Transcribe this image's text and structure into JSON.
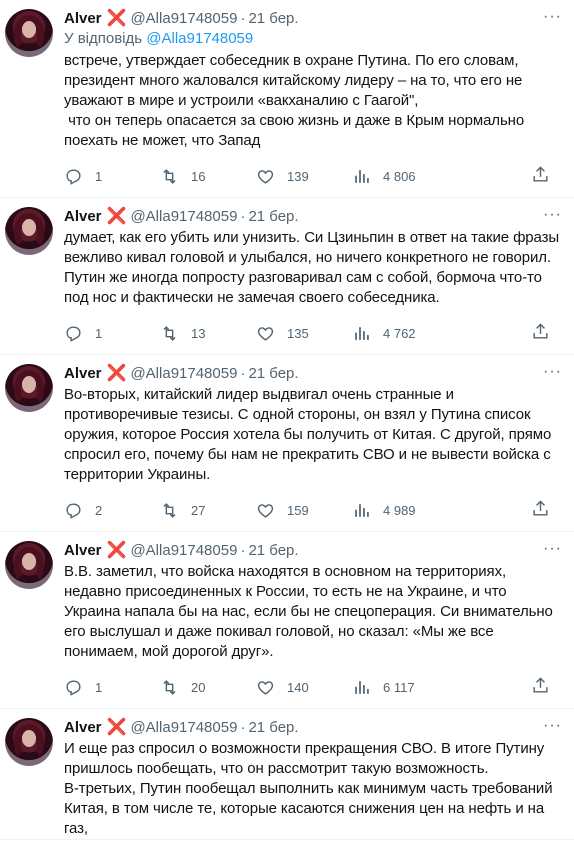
{
  "tweets": [
    {
      "name": "Alver",
      "badge": "❌",
      "handle": "@Alla91748059",
      "date": "21 бер.",
      "reply_prefix": "У відповідь",
      "reply_to": "@Alla91748059",
      "text": "встрече, утверждает собеседник в охране Путина. По его словам,\nпрезидент много жаловался китайскому лидеру – на то, что его не\nуважают в мире и устроили «вакханалию с Гаагой\",\n что он теперь опасается за свою жизнь и даже в Крым нормально\nпоехать не может, что Запад",
      "replies": "1",
      "retweets": "16",
      "likes": "139",
      "views": "4 806"
    },
    {
      "name": "Alver",
      "badge": "❌",
      "handle": "@Alla91748059",
      "date": "21 бер.",
      "text": "думает, как его убить или унизить. Си Цзиньпин в ответ на такие фразы\nвежливо кивал головой и улыбался, но ничего конкретного не говорил.\nПутин же иногда попросту разговаривал сам с собой, бормоча что-то\nпод нос и фактически не замечая своего собеседника.",
      "replies": "1",
      "retweets": "13",
      "likes": "135",
      "views": "4 762"
    },
    {
      "name": "Alver",
      "badge": "❌",
      "handle": "@Alla91748059",
      "date": "21 бер.",
      "text": "Во-вторых, китайский лидер выдвигал очень странные и\nпротиворечивые тезисы. С одной стороны, он взял у Путина список\nоружия, которое Россия хотела бы получить от Китая. С другой, прямо\nспросил его, почему бы нам не прекратить СВО и не вывести войска с\nтерритории Украины.",
      "replies": "2",
      "retweets": "27",
      "likes": "159",
      "views": "4 989"
    },
    {
      "name": "Alver",
      "badge": "❌",
      "handle": "@Alla91748059",
      "date": "21 бер.",
      "text": "В.В. заметил, что войска находятся в основном на территориях,\nнедавно присоединенных к России, то есть не на Украине, и что\nУкраина напала бы на нас, если бы не спецоперация. Си внимательно\nего выслушал и даже покивал головой, но сказал: «Мы же все\nпонимаем, мой дорогой друг».",
      "replies": "1",
      "retweets": "20",
      "likes": "140",
      "views": "6 117"
    },
    {
      "name": "Alver",
      "badge": "❌",
      "handle": "@Alla91748059",
      "date": "21 бер.",
      "text": "И еще раз спросил о возможности прекращения СВО. В итоге Путину\nпришлось пообещать, что он рассмотрит такую возможность.\nВ-третьих, Путин пообещал выполнить как минимум часть требований\nКитая, в том числе те, которые касаются снижения цен на нефть и на\nгаз,",
      "replies": "",
      "retweets": "",
      "likes": "",
      "views": ""
    }
  ],
  "icons": {
    "reply": "reply-icon",
    "retweet": "retweet-icon",
    "like": "heart-icon",
    "views": "views-icon",
    "share": "share-icon",
    "more": "more-icon"
  }
}
